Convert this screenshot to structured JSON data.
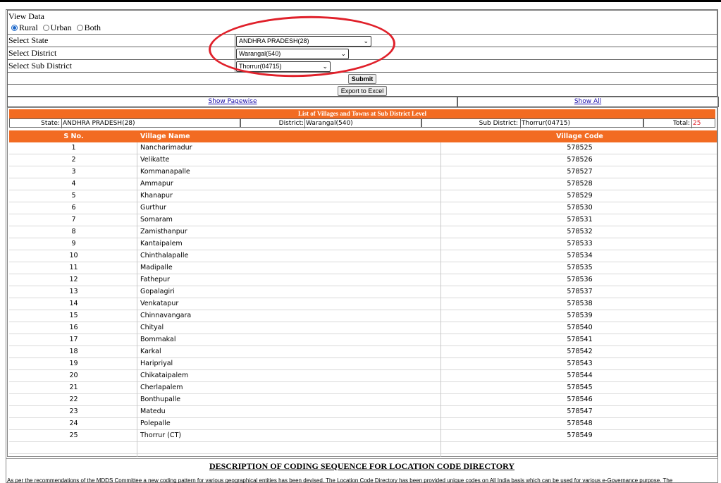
{
  "view_data": {
    "label": "View Data",
    "options": [
      "Rural",
      "Urban",
      "Both"
    ],
    "selected": "Rural"
  },
  "form": {
    "state_label": "Select State",
    "state_value": "ANDHRA PRADESH(28)",
    "district_label": "Select District",
    "district_value": "Warangal(540)",
    "subdistrict_label": "Select Sub District",
    "subdistrict_value": "Thorrur(04715)",
    "submit_label": "Submit",
    "export_label": "Export to Excel"
  },
  "links": {
    "pagewise": "Show Pagewise",
    "all": "Show All"
  },
  "table": {
    "title": "List of Villages and Towns at Sub District Level",
    "state_label": "State:",
    "state_value": "ANDHRA PRADESH(28)",
    "district_label": "District:",
    "district_value": "Warangal(540)",
    "subdistrict_label": "Sub District:",
    "subdistrict_value": "Thorrur(04715)",
    "total_label": "Total:",
    "total_value": "25",
    "columns": [
      "S No.",
      "Village Name",
      "Village Code"
    ],
    "rows": [
      [
        "1",
        "Nancharimadur",
        "578525"
      ],
      [
        "2",
        "Velikatte",
        "578526"
      ],
      [
        "3",
        "Kommanapalle",
        "578527"
      ],
      [
        "4",
        "Ammapur",
        "578528"
      ],
      [
        "5",
        "Khanapur",
        "578529"
      ],
      [
        "6",
        "Gurthur",
        "578530"
      ],
      [
        "7",
        "Somaram",
        "578531"
      ],
      [
        "8",
        "Zamisthanpur",
        "578532"
      ],
      [
        "9",
        "Kantaipalem",
        "578533"
      ],
      [
        "10",
        "Chinthalapalle",
        "578534"
      ],
      [
        "11",
        "Madipalle",
        "578535"
      ],
      [
        "12",
        "Fathepur",
        "578536"
      ],
      [
        "13",
        "Gopalagiri",
        "578537"
      ],
      [
        "14",
        "Venkatapur",
        "578538"
      ],
      [
        "15",
        "Chinnavangara",
        "578539"
      ],
      [
        "16",
        "Chityal",
        "578540"
      ],
      [
        "17",
        "Bommakal",
        "578541"
      ],
      [
        "18",
        "Karkal",
        "578542"
      ],
      [
        "19",
        "Haripriyal",
        "578543"
      ],
      [
        "20",
        "Chikataipalem",
        "578544"
      ],
      [
        "21",
        "Cherlapalem",
        "578545"
      ],
      [
        "22",
        "Bonthupalle",
        "578546"
      ],
      [
        "23",
        "Matedu",
        "578547"
      ],
      [
        "24",
        "Polepalle",
        "578548"
      ],
      [
        "25",
        "Thorrur (CT)",
        "578549"
      ]
    ]
  },
  "description": {
    "heading": "DESCRIPTION OF CODING SEQUENCE FOR LOCATION CODE DIRECTORY",
    "paragraph_start": "As per the recommendations of the MDDS Committee a new coding pattern for various geographical entities has been devised. The Location Code Directory has been provided unique codes on All India basis which can be used for various e-Governance purpose. The"
  },
  "colors": {
    "accent": "#f26b22",
    "highlight_ring": "#e0202a",
    "link": "#1a0dab",
    "total": "#e0202a"
  }
}
